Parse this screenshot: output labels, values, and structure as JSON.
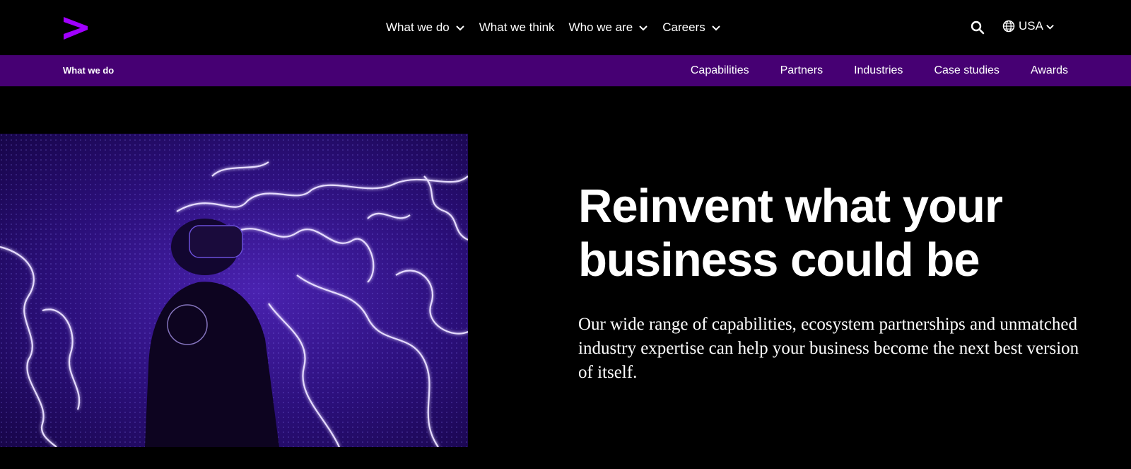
{
  "brand": {
    "accent_color": "#A100FF",
    "subnav_color": "#460073",
    "logo_icon": "accenture-greater-than-logo"
  },
  "header": {
    "nav": [
      {
        "label": "What we do",
        "has_dropdown": true
      },
      {
        "label": "What we think",
        "has_dropdown": false
      },
      {
        "label": "Who we are",
        "has_dropdown": true
      },
      {
        "label": "Careers",
        "has_dropdown": true
      }
    ],
    "search_icon": "search-icon",
    "locale": {
      "label": "USA",
      "icon": "globe-icon"
    }
  },
  "subnav": {
    "title": "What we do",
    "links": [
      "Capabilities",
      "Partners",
      "Industries",
      "Case studies",
      "Awards"
    ]
  },
  "hero": {
    "title_line1": "Reinvent what your",
    "title_line2": "business could be",
    "body": "Our wide range of capabilities, ecosystem partnerships and unmatched industry expertise can help your business become the next best version of itself."
  }
}
